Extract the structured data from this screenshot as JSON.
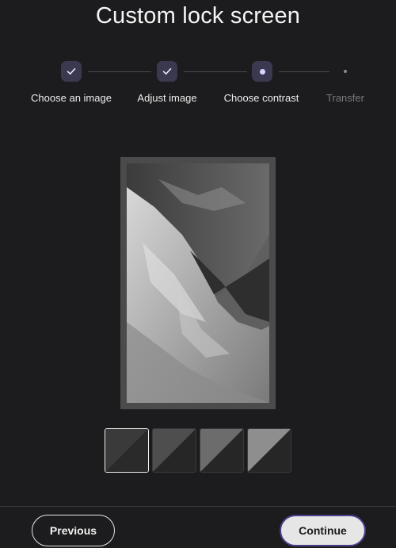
{
  "header": {
    "title": "Custom lock screen"
  },
  "stepper": {
    "steps": [
      {
        "label": "Choose an image",
        "state": "done"
      },
      {
        "label": "Adjust image",
        "state": "done"
      },
      {
        "label": "Choose contrast",
        "state": "current"
      },
      {
        "label": "Transfer",
        "state": "upcoming"
      }
    ]
  },
  "preview": {
    "icon": "mountain-image"
  },
  "contrast": {
    "options": [
      {
        "light": "#3a3a3a",
        "dark": "#2a2a2a",
        "selected": true
      },
      {
        "light": "#4e4e4e",
        "dark": "#262626",
        "selected": false
      },
      {
        "light": "#6c6c6c",
        "dark": "#262626",
        "selected": false
      },
      {
        "light": "#8e8e8e",
        "dark": "#262626",
        "selected": false
      }
    ]
  },
  "footer": {
    "previous_label": "Previous",
    "continue_label": "Continue"
  },
  "colors": {
    "background": "#1c1c1e",
    "accent": "#d8d3ff",
    "step_badge": "#3a3950"
  }
}
